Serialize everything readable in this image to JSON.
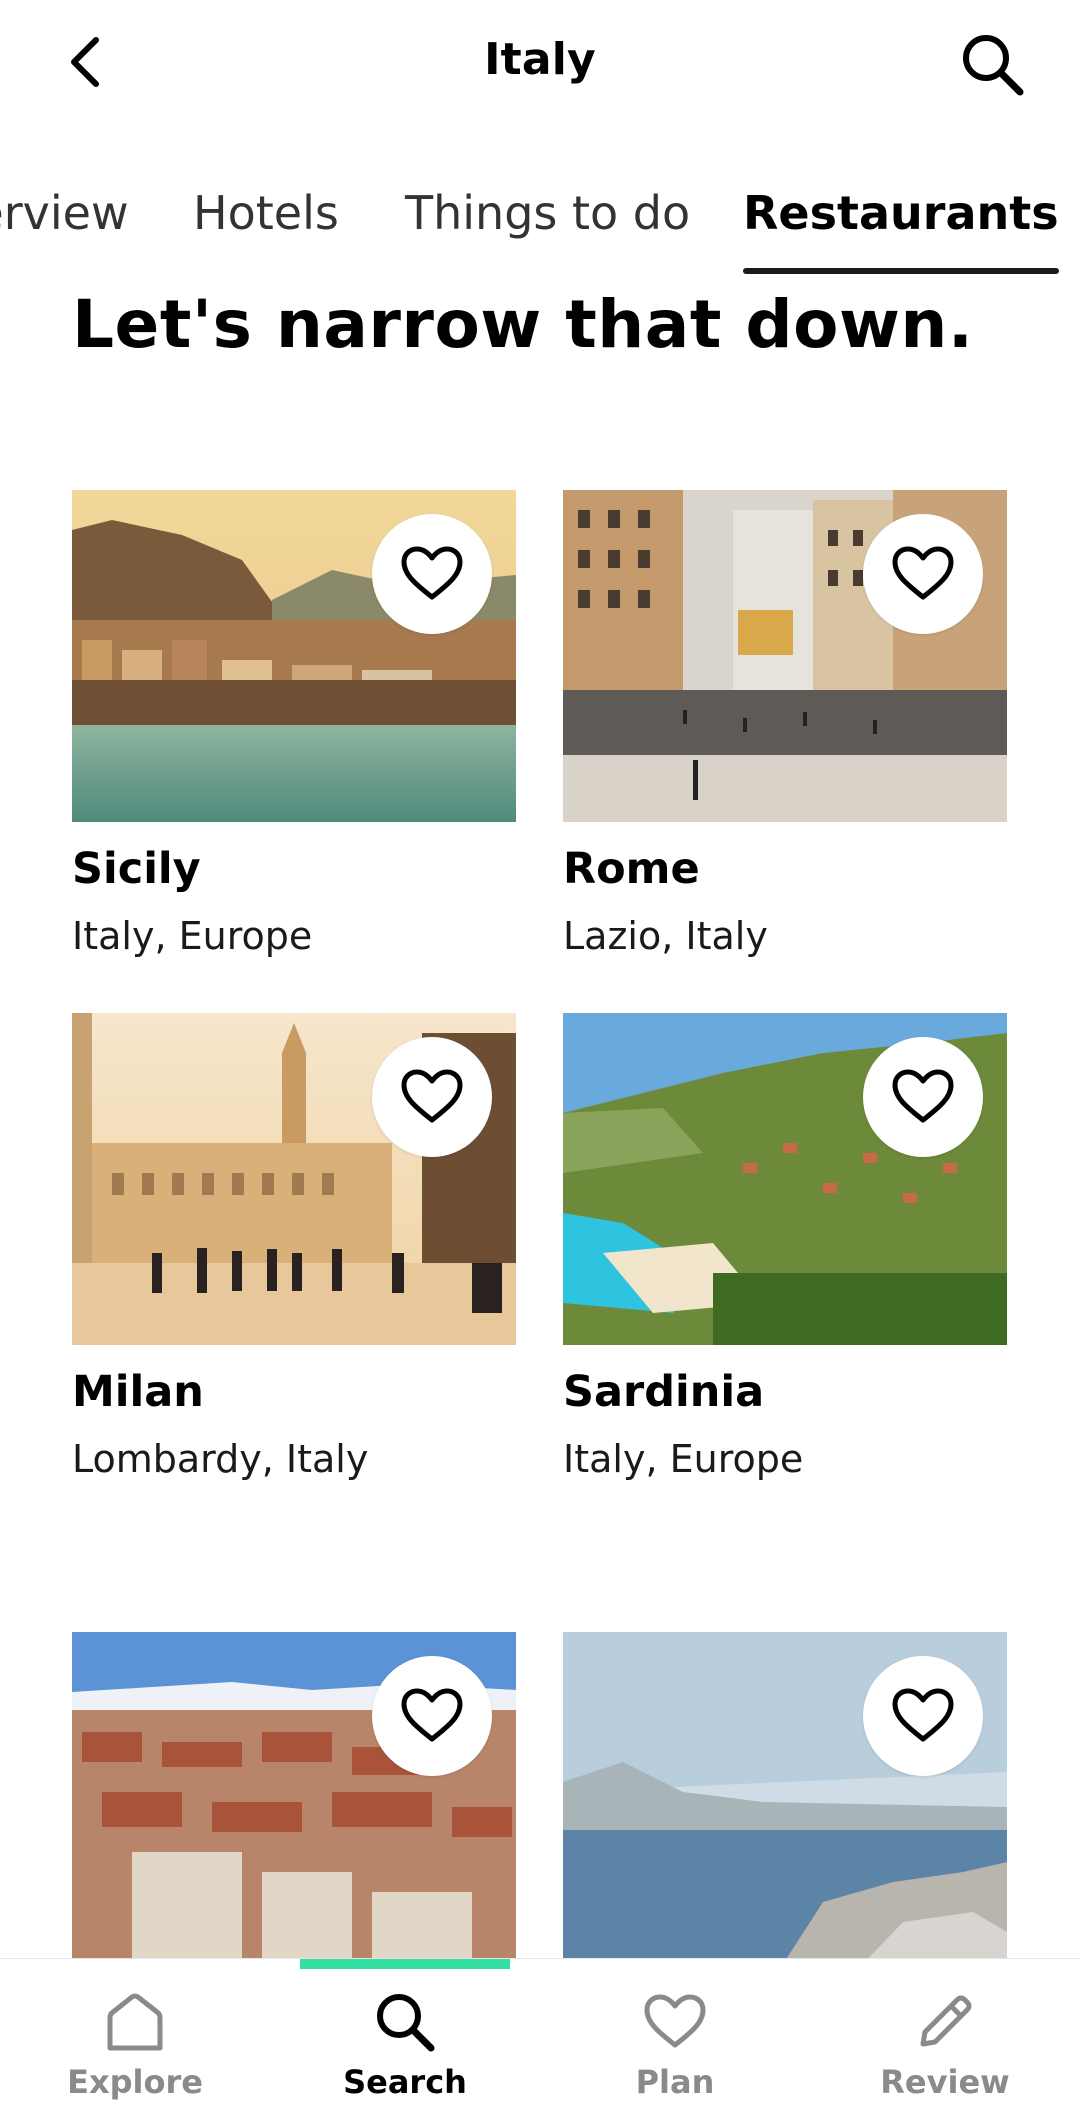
{
  "header": {
    "title": "Italy"
  },
  "tabs": [
    {
      "label": "Overview"
    },
    {
      "label": "Hotels"
    },
    {
      "label": "Things to do"
    },
    {
      "label": "Restaurants",
      "active": true
    }
  ],
  "heading": "Let's narrow that down.",
  "destinations": [
    {
      "name": "Sicily",
      "region": "Italy, Europe"
    },
    {
      "name": "Rome",
      "region": "Lazio, Italy"
    },
    {
      "name": "Milan",
      "region": "Lombardy, Italy"
    },
    {
      "name": "Sardinia",
      "region": "Italy, Europe"
    },
    {
      "name": "",
      "region": ""
    },
    {
      "name": "",
      "region": ""
    }
  ],
  "bottom_nav": [
    {
      "label": "Explore",
      "icon": "home-icon"
    },
    {
      "label": "Search",
      "icon": "search-icon",
      "active": true
    },
    {
      "label": "Plan",
      "icon": "heart-icon"
    },
    {
      "label": "Review",
      "icon": "pencil-icon"
    }
  ],
  "colors": {
    "accent": "#34e0a1",
    "text": "#000000",
    "muted": "#8a8a8a"
  }
}
